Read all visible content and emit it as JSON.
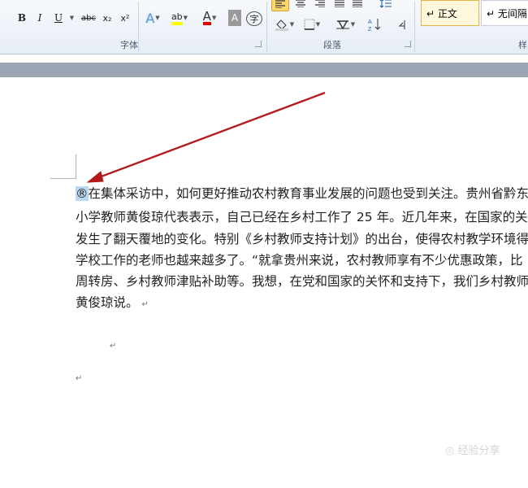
{
  "ribbon": {
    "font_group_label": "字体",
    "paragraph_group_label": "段落",
    "styles_group_label": "样",
    "bold": "B",
    "italic": "I",
    "underline": "U",
    "strikethrough": "abc",
    "subscript": "x₂",
    "superscript": "x²",
    "text_effects": "A",
    "highlight": "ab",
    "font_color": "A",
    "char_shading": "A",
    "enclose_char": "字",
    "style_normal": "↵ 正文",
    "style_no_spacing": "↵ 无间隔",
    "colors": {
      "highlight": "#ffff00",
      "font_color": "#e00000",
      "active_button": "#fbd86f"
    }
  },
  "document": {
    "lines": [
      {
        "lead": "®",
        "text": "在集体采访中，如何更好推动农村教育事业发展的问题也受到关注。贵州省黔东"
      },
      {
        "text": "小学教师黄俊琼代表表示，自己已经在乡村工作了 25 年。近几年来，在国家的关"
      },
      {
        "text": "发生了翻天覆地的变化。特别《乡村教师支持计划》的出台，使得农村教学环境得"
      },
      {
        "text": "学校工作的老师也越来越多了。“就拿贵州来说，农村教师享有不少优惠政策，比"
      },
      {
        "text": "周转房、乡村教师津贴补助等。我想，在党和国家的关怀和支持下，我们乡村教师"
      },
      {
        "text": "黄俊琼说。"
      }
    ],
    "paragraph_mark": "↵",
    "annotation_arrow_color": "#b31b1b"
  },
  "watermark": "◎ 经验分享"
}
